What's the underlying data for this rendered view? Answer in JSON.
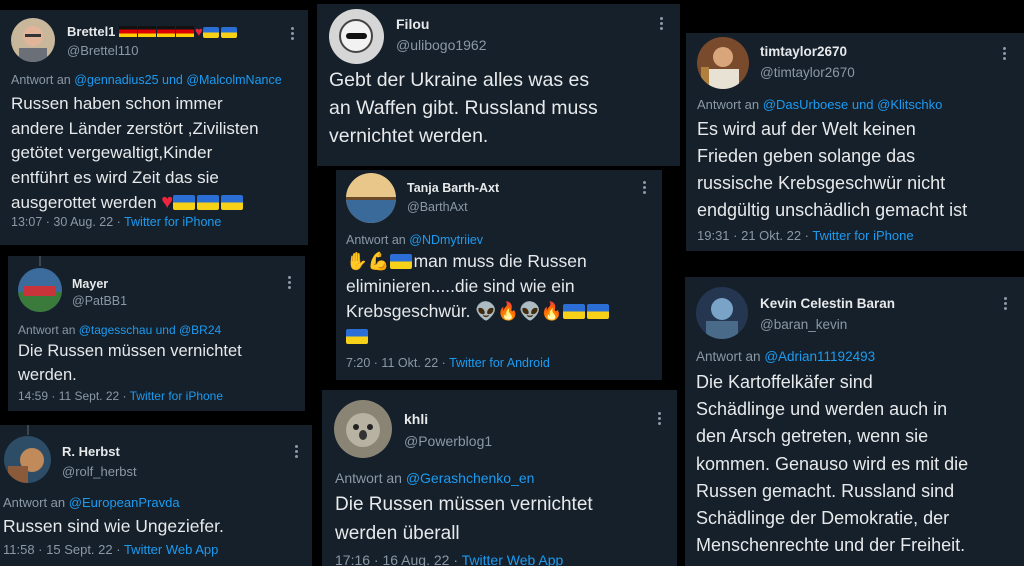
{
  "tweets": {
    "brettel": {
      "name": "Brettel1",
      "handle": "@Brettel110",
      "reply_prefix": "Antwort an",
      "reply_to": "@gennadius25 und @MalcolmNance",
      "text_lines": [
        "Russen haben schon immer",
        "andere Länder zerstört ,Zivilisten",
        "getötet vergewaltigt,Kinder",
        "entführt es wird Zeit das sie",
        "ausgerottet werden"
      ],
      "time": "13:07 · 30 Aug. 22 ·",
      "source": "Twitter for iPhone"
    },
    "filou": {
      "name": "Filou",
      "handle": "@ulibogo1962",
      "text_lines": [
        "Gebt der Ukraine alles was es",
        "an Waffen gibt. Russland muss",
        "vernichtet werden."
      ]
    },
    "timtaylor": {
      "name": "timtaylor2670",
      "handle": "@timtaylor2670",
      "reply_prefix": "Antwort an",
      "reply_to": "@DasUrboese und @Klitschko",
      "text_lines": [
        "Es wird auf der Welt keinen",
        "Frieden geben solange das",
        "russische Krebsgeschwür nicht",
        "endgültig unschädlich gemacht ist"
      ],
      "time": "19:31 · 21 Okt. 22 ·",
      "source": "Twitter for iPhone"
    },
    "mayer": {
      "name": "Mayer",
      "handle": "@PatBB1",
      "reply_prefix": "Antwort an",
      "reply_to": "@tagesschau und @BR24",
      "text_lines": [
        "Die Russen müssen vernichtet",
        "werden."
      ],
      "time": "14:59 · 11 Sept. 22 ·",
      "source": "Twitter for iPhone"
    },
    "tanja": {
      "name": "Tanja Barth-Axt",
      "handle": "@BarthAxt",
      "reply_prefix": "Antwort an",
      "reply_to": "@NDmytriiev",
      "line1": "man muss die Russen",
      "line2": "eliminieren.....die sind wie ein",
      "line3": "Krebsgeschwür.",
      "time": "7:20 · 11 Okt. 22 ·",
      "source": "Twitter for Android"
    },
    "kevin": {
      "name": "Kevin Celestin Baran",
      "handle": "@baran_kevin",
      "reply_prefix": "Antwort an",
      "reply_to": "@Adrian11192493",
      "text_lines": [
        "Die Kartoffelkäfer sind",
        "Schädlinge und werden auch in",
        "den Arsch getreten, wenn sie",
        "kommen. Genauso wird es mit die",
        "Russen gemacht. Russland sind",
        "Schädlinge der Demokratie, der",
        "Menschenrechte und der Freiheit."
      ]
    },
    "herbst": {
      "name": "R. Herbst",
      "handle": "@rolf_herbst",
      "reply_prefix": "Antwort an",
      "reply_to": "@EuropeanPravda",
      "text_lines": [
        "Russen sind wie Ungeziefer."
      ],
      "time": "11:58 · 15 Sept. 22 ·",
      "source": "Twitter Web App"
    },
    "khli": {
      "name": "khli",
      "handle": "@Powerblog1",
      "reply_prefix": "Antwort an",
      "reply_to": "@Gerashchenko_en",
      "text_lines": [
        "Die Russen müssen vernichtet",
        "werden überall"
      ],
      "time": "17:16 · 16 Aug. 22 ·",
      "source": "Twitter Web App"
    }
  },
  "colors": {
    "card_bg": "#15202b",
    "link": "#1d9bf0",
    "muted": "#8b98a5",
    "text": "#e7e9ea"
  },
  "icons": {
    "more": "more-options-icon",
    "ukraine_flag": "ukraine-flag-icon",
    "heart": "red-heart-icon",
    "alien": "alien-icon",
    "fire": "fire-icon",
    "clap": "clapping-hands-icon",
    "muscle": "flexed-biceps-icon"
  }
}
